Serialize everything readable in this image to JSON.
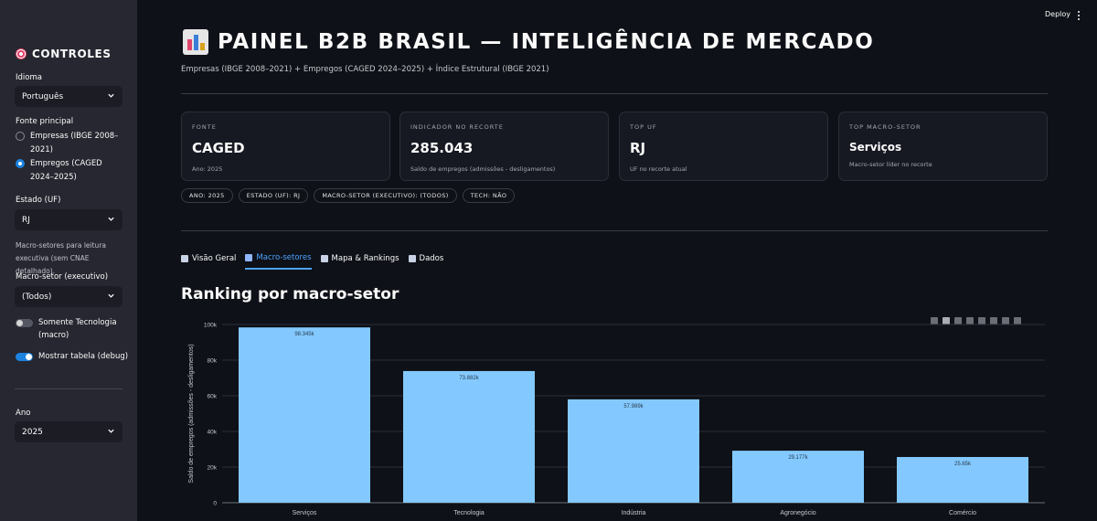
{
  "sidebar": {
    "title": "CONTROLES",
    "title_icon": "dart-target-icon",
    "language_label": "Idioma",
    "language_value": "Português",
    "source_label": "Fonte principal",
    "source_options": [
      "Empresas (IBGE 2008–2021)",
      "Empregos (CAGED 2024–2025)"
    ],
    "source_selected_index": 1,
    "state_label": "Estado (UF)",
    "state_value": "RJ",
    "macro_note": "Macro-setores para leitura executiva (sem CNAE detalhado).",
    "macro_label": "Macro-setor (executivo)",
    "macro_value": "(Todos)",
    "toggle_tech": "Somente Tecnologia (macro)",
    "toggle_tech_on": false,
    "toggle_debug": "Mostrar tabela (debug)",
    "toggle_debug_on": true,
    "year_label": "Ano",
    "year_value": "2025"
  },
  "header": {
    "deploy": "Deploy",
    "title": "PAINEL B2B BRASIL — INTELIGÊNCIA DE MERCADO",
    "subtitle": "Empresas (IBGE 2008–2021) + Empregos (CAGED 2024–2025) + Índice Estrutural (IBGE 2021)"
  },
  "cards": [
    {
      "label": "FONTE",
      "value": "CAGED",
      "sub": "Ano: 2025"
    },
    {
      "label": "INDICADOR NO RECORTE",
      "value": "285.043",
      "sub": "Saldo de empregos (admissões - desligamentos)"
    },
    {
      "label": "TOP UF",
      "value": "RJ",
      "sub": "UF no recorte atual"
    },
    {
      "label": "TOP MACRO-SETOR",
      "value": "Serviços",
      "sub": "Macro-setor líder no recorte"
    }
  ],
  "chips": [
    "ANO: 2025",
    "ESTADO (UF): RJ",
    "MACRO-SETOR (EXECUTIVO): (TODOS)",
    "TECH: NÃO"
  ],
  "tabs": [
    {
      "label": "Visão Geral",
      "icon": "chart-increasing-icon"
    },
    {
      "label": "Macro-setores",
      "icon": "factory-icon"
    },
    {
      "label": "Mapa & Rankings",
      "icon": "world-map-icon"
    },
    {
      "label": "Dados",
      "icon": "page-icon"
    }
  ],
  "active_tab": 1,
  "section_title": "Ranking por macro-setor",
  "colors": {
    "bar": "#83c9ff",
    "accent": "#1c83e1",
    "background": "#0e1117",
    "sidebar": "#262730"
  },
  "chart_data": {
    "type": "bar",
    "categories": [
      "Serviços",
      "Tecnologia",
      "Indústria",
      "Agronegócio",
      "Comércio"
    ],
    "values": [
      98345,
      73882,
      57989,
      29177,
      25650
    ],
    "value_labels": [
      "98.345k",
      "73.882k",
      "57.989k",
      "29.177k",
      "25.65k"
    ],
    "ylabel": "Saldo de empregos (admissões - desligamentos)",
    "xlabel": "",
    "ylim": [
      0,
      100000
    ],
    "yticks": [
      0,
      20000,
      40000,
      60000,
      80000,
      100000
    ],
    "ytick_labels": [
      "0",
      "20k",
      "40k",
      "60k",
      "80k",
      "100k"
    ],
    "grid": true
  }
}
